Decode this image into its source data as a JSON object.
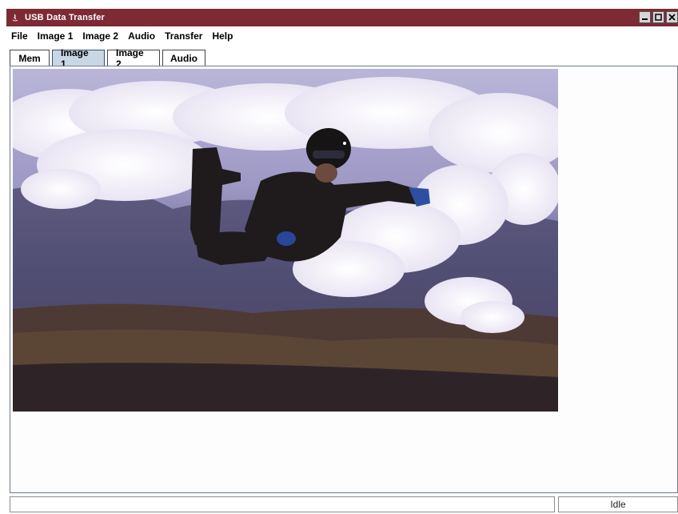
{
  "window": {
    "title": "USB Data Transfer",
    "title_bar_color": "#7d2a34"
  },
  "menu": {
    "items": [
      "File",
      "Image 1",
      "Image 2",
      "Audio",
      "Transfer",
      "Help"
    ]
  },
  "tabs": {
    "items": [
      "Mem",
      "Image 1",
      "Image 2",
      "Audio"
    ],
    "active": "Image 1",
    "active_color": "#c9d6e6"
  },
  "image": {
    "subject": "skydiver-photo"
  },
  "status": {
    "message": "",
    "state": "Idle"
  }
}
